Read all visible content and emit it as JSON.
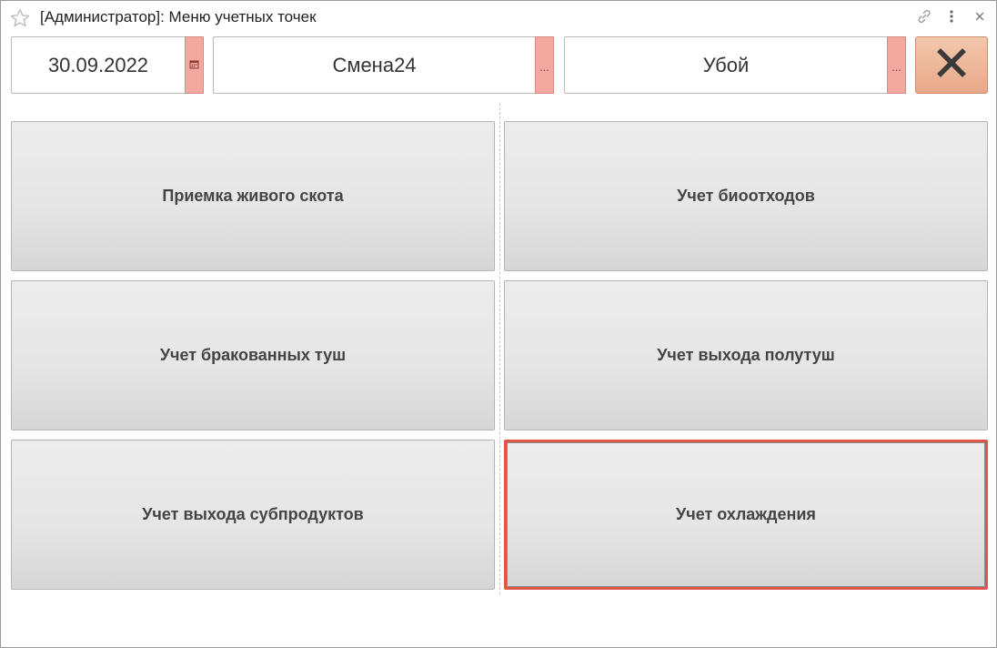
{
  "window": {
    "title": "[Администратор]: Меню учетных точек",
    "icons": [
      "star-icon",
      "link-icon",
      "more-vertical-icon",
      "close-icon"
    ]
  },
  "filters": {
    "date": {
      "value": "30.09.2022",
      "button_icon": "calendar-icon"
    },
    "shift": {
      "value": "Смена24",
      "button_label": "..."
    },
    "operation": {
      "value": "Убой",
      "button_label": "..."
    },
    "close_button_icon": "close-x-icon"
  },
  "tiles": [
    {
      "label": "Приемка живого скота"
    },
    {
      "label": "Учет биоотходов"
    },
    {
      "label": "Учет бракованных туш"
    },
    {
      "label": "Учет выхода полутуш"
    },
    {
      "label": "Учет выхода субпродуктов"
    },
    {
      "label": "Учет охлаждения",
      "selected": true
    }
  ],
  "colors": {
    "field_button": "#f3a8a0",
    "close_button": "#eab497",
    "selection_border": "#e0574a",
    "tile_background": "#e6e6e6"
  }
}
